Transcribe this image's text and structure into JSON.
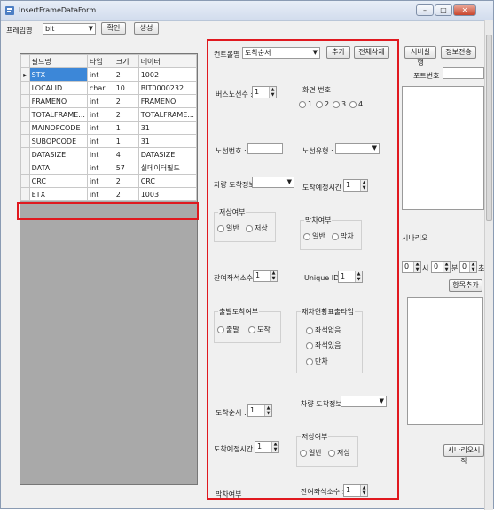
{
  "window": {
    "title": "InsertFrameDataForm",
    "min": "–",
    "max": "□",
    "close": "✕"
  },
  "top": {
    "frame_name_label": "프레임명",
    "frame_name_value": "bit",
    "confirm_button": "확인",
    "generate_button": "생성"
  },
  "grid": {
    "columns": [
      "필드명",
      "타입",
      "크기",
      "데이터"
    ],
    "rows": [
      [
        "STX",
        "int",
        "2",
        "1002"
      ],
      [
        "LOCALID",
        "char",
        "10",
        "BIT0000232"
      ],
      [
        "FRAMENO",
        "int",
        "2",
        "FRAMENO"
      ],
      [
        "TOTALFRAME...",
        "int",
        "2",
        "TOTALFRAME..."
      ],
      [
        "MAINOPCODE",
        "int",
        "1",
        "31"
      ],
      [
        "SUBOPCODE",
        "int",
        "1",
        "31"
      ],
      [
        "DATASIZE",
        "int",
        "4",
        "DATASIZE"
      ],
      [
        "DATA",
        "int",
        "57",
        "실데이터필드"
      ],
      [
        "CRC",
        "int",
        "2",
        "CRC"
      ],
      [
        "ETX",
        "int",
        "2",
        "1003"
      ]
    ],
    "current_row_marker": "▸"
  },
  "content": {
    "content_type_label": "컨트롤명",
    "content_type_value": "도착순서",
    "add_button": "추가",
    "delete_all_button": "전체삭제",
    "bus_line_count_label": "버스노선수 :",
    "bus_line_count_value": "1",
    "screen_no_label": "화면 번호",
    "screen_options": [
      "1",
      "2",
      "3",
      "4"
    ],
    "route_no_label": "노선번호 :",
    "route_type_label": "노선유형 :",
    "vehicle_arrival_label": "차량 도착정보:",
    "arrival_time_label": "도착예정시간 :",
    "arrival_time_value": "1",
    "low_floor_group": "저상여부",
    "low_floor_opts": [
      "일반",
      "저상"
    ],
    "last_bus_group": "막차여부",
    "last_bus_opts": [
      "일반",
      "막차"
    ],
    "remaining_seats_label": "잔여좌석소수 :",
    "remaining_seats_value": "1",
    "unique_id_label": "Unique ID :",
    "unique_id_value": "1",
    "departure_group": "출발도착여부",
    "departure_opts": [
      "출발",
      "도착"
    ],
    "congestion_group": "재차현황표출타입",
    "congestion_opts": [
      "좌석없음",
      "좌석있음",
      "만차"
    ],
    "arrival_order_label": "도착순서 :",
    "arrival_order_value": "1",
    "vehicle_arrival2_label": "차량 도착정보:",
    "arrival_time2_label": "도착예정시간 :",
    "arrival_time2_value": "1",
    "low_floor2_group": "저상여부",
    "low_floor2_opts": [
      "일반",
      "저상"
    ],
    "cut_label_1": "막차여부",
    "cut_label_2": "잔여좌석소수 :",
    "cut_value_2": "1"
  },
  "right": {
    "server_run_button": "서버실행",
    "info_send_button": "정보전송",
    "port_label": "포트번호",
    "scenario_label": "시나리오",
    "time_hour": "0",
    "time_hour_unit": "시",
    "time_min": "0",
    "time_min_unit": "분",
    "time_sec": "0",
    "time_sec_unit": "초",
    "add_item_button": "항목추가",
    "scenario_start_button": "시나리오시작"
  }
}
